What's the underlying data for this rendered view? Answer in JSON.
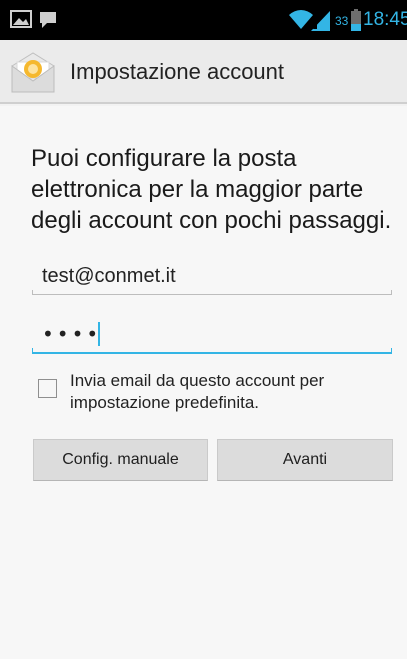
{
  "status_bar": {
    "battery_level": "33",
    "time": "18:45",
    "icons": [
      "picture-icon",
      "message-icon",
      "wifi-icon",
      "signal-icon",
      "battery-icon"
    ],
    "accent_color": "#33b5e5"
  },
  "action_bar": {
    "title": "Impostazione account",
    "icon": "email-app-icon"
  },
  "form": {
    "intro": "Puoi configurare la posta elettronica per la maggior parte degli account con pochi passaggi.",
    "email_value": "test@conmet.it",
    "password_mask": "••••",
    "default_account_checked": false,
    "default_account_label": "Invia email da questo account per impostazione predefinita."
  },
  "buttons": {
    "manual_label": "Config. manuale",
    "next_label": "Avanti"
  }
}
